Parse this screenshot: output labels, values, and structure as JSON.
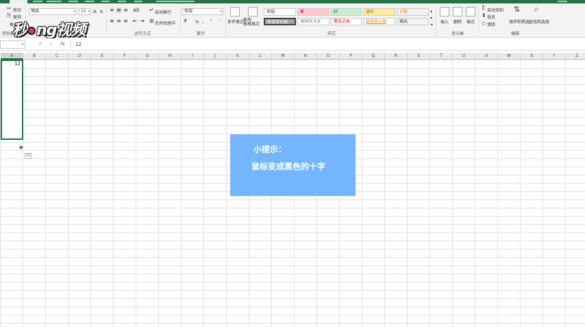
{
  "ribbon": {
    "clipboard": {
      "cut_label": "剪切",
      "copy_label": "复制",
      "paste_format_label": "格式",
      "group_label": "剪贴板"
    },
    "font": {
      "font_name": "等线",
      "font_size": "11",
      "grow_label": "A",
      "shrink_label": "A"
    },
    "alignment": {
      "wrap_label": "自动换行",
      "merge_label": "合并后居中",
      "group_label": "对齐方式"
    },
    "number": {
      "format_value": "常规",
      "percent_label": "%",
      "group_label": "数字"
    },
    "styles": {
      "cond_format_label": "条件格式",
      "table_format_label": "套用\n表格格式",
      "cells": [
        {
          "label": "常规",
          "bg": "#ffffff",
          "color": "#333333"
        },
        {
          "label": "差",
          "bg": "#ffc7ce",
          "color": "#9c0006"
        },
        {
          "label": "好",
          "bg": "#c6efce",
          "color": "#006100"
        },
        {
          "label": "适中",
          "bg": "#ffeb9c",
          "color": "#9c5700"
        },
        {
          "label": "计算",
          "bg": "#f2f2f2",
          "color": "#fa7d00"
        },
        {
          "label": "检查单元格",
          "bg": "#a5a5a5",
          "color": "#ffffff"
        },
        {
          "label": "解释性文本",
          "bg": "#ffffff",
          "color": "#7f7f7f"
        },
        {
          "label": "警告文本",
          "bg": "#ffffff",
          "color": "#ff0000"
        },
        {
          "label": "链接单元格",
          "bg": "#ffffff",
          "color": "#fa7d00"
        },
        {
          "label": "输出",
          "bg": "#f2f2f2",
          "color": "#3f3f3f"
        }
      ],
      "group_label": "样式"
    },
    "cells_group": {
      "insert_label": "插入",
      "delete_label": "删除",
      "format_label": "格式",
      "group_label": "单元格"
    },
    "editing": {
      "autosum_label": "自动求和",
      "fill_label": "填充",
      "clear_label": "清除",
      "sort_label": "排序和筛选",
      "find_label": "查找和选择",
      "group_label": "编辑"
    }
  },
  "logo_text": {
    "part1": "秒",
    "part2": "ng视频"
  },
  "formula_bar": {
    "name_box": "",
    "cancel_icon": "✕",
    "enter_icon": "✓",
    "fx_label": "fx",
    "content": "12"
  },
  "columns": [
    "A",
    "B",
    "C",
    "D",
    "E",
    "F",
    "G",
    "H",
    "I",
    "J",
    "K",
    "L",
    "M",
    "N",
    "O",
    "P",
    "Q",
    "R",
    "S",
    "T",
    "U",
    "V",
    "W",
    "X",
    "Y",
    "Z"
  ],
  "active_cell": {
    "column": "A",
    "value": "12"
  },
  "quick_analysis_label": "12",
  "tip": {
    "title": "小提示：",
    "body": "鼠标变成黑色的十字"
  }
}
